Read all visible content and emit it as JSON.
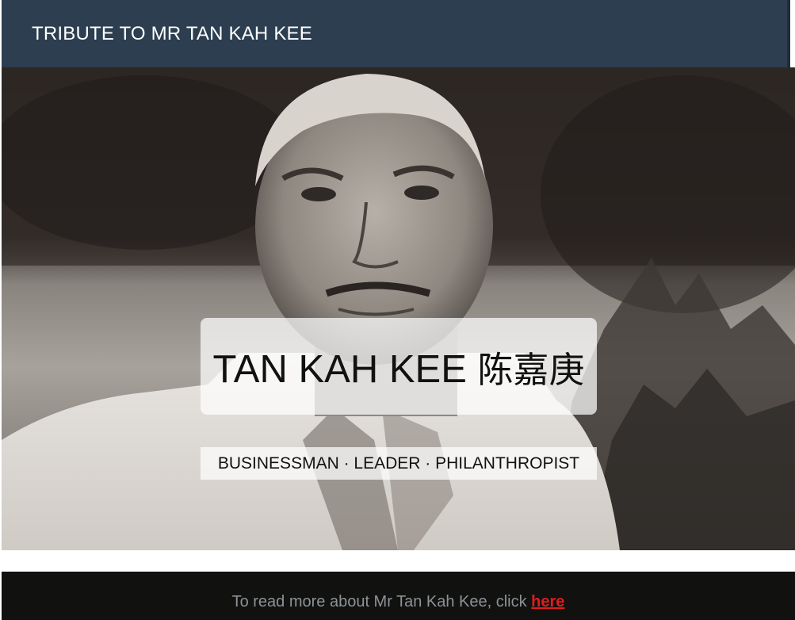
{
  "header": {
    "site_title": "TRIBUTE TO MR TAN KAH KEE"
  },
  "hero": {
    "name_en": "TAN KAH KEE",
    "name_zh": "陈嘉庚",
    "tagline": "BUSINESSMAN · LEADER · PHILANTHROPIST"
  },
  "footer": {
    "text": "To read more about Mr Tan Kah Kee, click",
    "link_label": "here"
  },
  "colors": {
    "header_bg": "#2c3e50",
    "footer_bg": "#111110",
    "footer_text": "#8c9296",
    "link": "#e31b1b"
  }
}
